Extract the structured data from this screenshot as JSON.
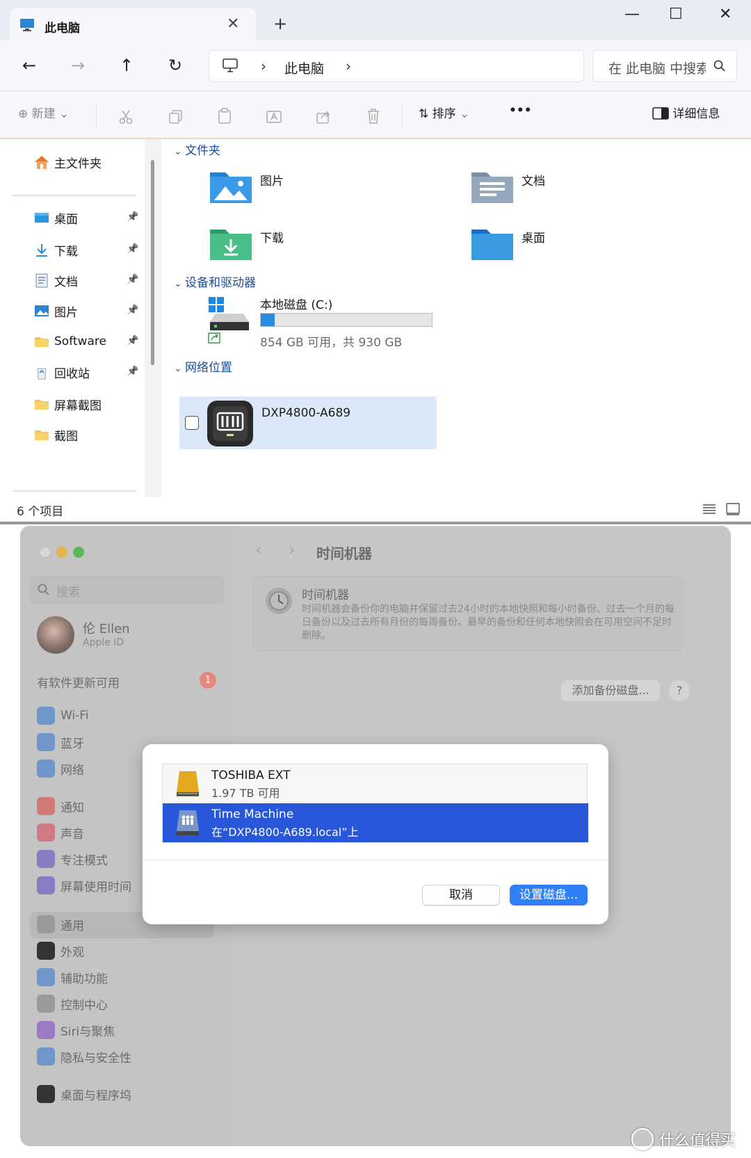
{
  "explorer": {
    "tab_title": "此电脑",
    "new_tab": "+",
    "window_controls": {
      "minimize": "—",
      "maximize": "☐",
      "close": "✕"
    },
    "nav": {
      "back": "←",
      "forward": "→",
      "up": "↑",
      "refresh": "↻"
    },
    "breadcrumb": {
      "separator": "›",
      "location": "此电脑"
    },
    "search_placeholder": "在 此电脑 中搜索",
    "toolbar": {
      "new_label": "新建",
      "sort_label": "排序",
      "more": "•••",
      "details_label": "详细信息"
    },
    "sidebar": {
      "home": "主文件夹",
      "items": [
        {
          "label": "桌面",
          "pinned": true,
          "icon": "desktop-icon"
        },
        {
          "label": "下载",
          "pinned": true,
          "icon": "download-icon"
        },
        {
          "label": "文档",
          "pinned": true,
          "icon": "document-icon"
        },
        {
          "label": "图片",
          "pinned": true,
          "icon": "pictures-icon"
        },
        {
          "label": "Software",
          "pinned": true,
          "icon": "folder-icon"
        },
        {
          "label": "回收站",
          "pinned": true,
          "icon": "recycle-bin-icon"
        },
        {
          "label": "屏幕截图",
          "pinned": false,
          "icon": "folder-icon"
        },
        {
          "label": "截图",
          "pinned": false,
          "icon": "folder-icon"
        }
      ]
    },
    "sections": {
      "folders": "文件夹",
      "drives": "设备和驱动器",
      "network": "网络位置"
    },
    "folders": [
      {
        "label": "图片",
        "icon": "pictures-folder-icon"
      },
      {
        "label": "文档",
        "icon": "documents-folder-icon"
      },
      {
        "label": "下载",
        "icon": "downloads-folder-icon"
      },
      {
        "label": "桌面",
        "icon": "desktop-folder-icon"
      }
    ],
    "drive": {
      "name": "本地磁盘 (C:)",
      "free_text": "854 GB 可用，共 930 GB",
      "used_fraction": 0.082
    },
    "network_location": {
      "name": "DXP4800-A689"
    },
    "status": {
      "count": "6 个项目"
    }
  },
  "mac": {
    "search_placeholder": "搜索",
    "user": {
      "name": "伦 Ellen",
      "sub": "Apple ID"
    },
    "update": {
      "label": "有软件更新可用",
      "badge": "1"
    },
    "menu_group1": [
      {
        "label": "Wi-Fi",
        "color": "#6f96c9"
      },
      {
        "label": "蓝牙",
        "color": "#6f96c9"
      },
      {
        "label": "网络",
        "color": "#6f96c9"
      }
    ],
    "menu_group2": [
      {
        "label": "通知",
        "color": "#d07a7a"
      },
      {
        "label": "声音",
        "color": "#d07a85"
      },
      {
        "label": "专注模式",
        "color": "#8a7cc2"
      },
      {
        "label": "屏幕使用时间",
        "color": "#8a7cc2"
      }
    ],
    "menu_group3": [
      {
        "label": "通用",
        "color": "#9a9a9a"
      },
      {
        "label": "外观",
        "color": "#333333"
      },
      {
        "label": "辅助功能",
        "color": "#6f96c9"
      },
      {
        "label": "控制中心",
        "color": "#9a9a9a"
      },
      {
        "label": "Siri与聚焦",
        "color": "#9a7ac2"
      },
      {
        "label": "隐私与安全性",
        "color": "#6f96c9"
      }
    ],
    "menu_group4": [
      {
        "label": "桌面与程序坞",
        "color": "#333333"
      }
    ],
    "main": {
      "back": "‹",
      "forward": "›",
      "title": "时间机器",
      "tm_title": "时间机器",
      "tm_desc": "时间机器会备份你的电脑并保留过去24小时的本地快照和每小时备份、过去一个月的每日备份以及过去所有月份的每周备份。最早的备份和任何本地快照会在可用空间不足时删除。",
      "add_disk": "添加备份磁盘...",
      "help": "?"
    },
    "sheet": {
      "disks": [
        {
          "name": "TOSHIBA EXT",
          "sub": "1.97 TB 可用",
          "selected": false
        },
        {
          "name": "Time Machine",
          "sub": "在“DXP4800-A689.local”上",
          "selected": true
        }
      ],
      "cancel": "取消",
      "confirm": "设置磁盘..."
    }
  },
  "watermark": "什么值得买"
}
